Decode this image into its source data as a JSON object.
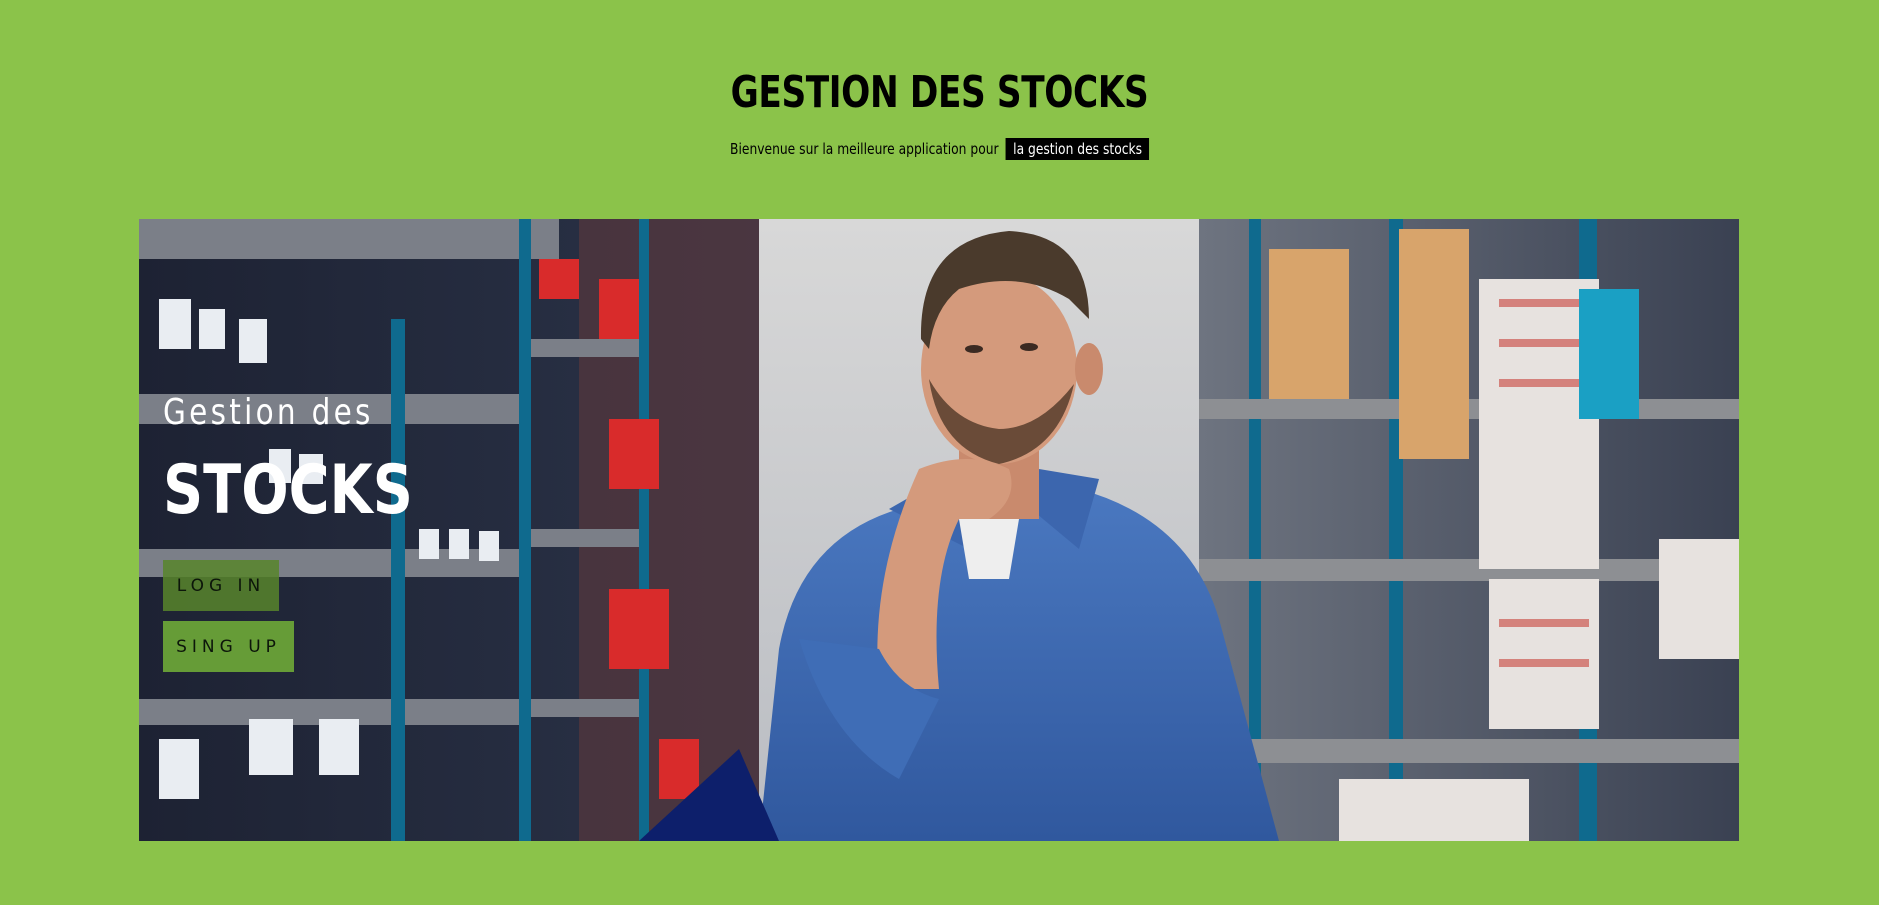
{
  "header": {
    "title": "GESTION DES STOCKS",
    "subtitle_prefix": "Bienvenue sur la meilleure application pour",
    "subtitle_highlight": "la gestion des stocks"
  },
  "hero": {
    "kicker": "Gestion des",
    "heading": "STOCKS",
    "login_label": "LOG IN",
    "signup_label": "SING UP"
  },
  "colors": {
    "page_background": "#8bc34a",
    "title_text": "#000000",
    "highlight_background": "#000000",
    "button_background": "#58852c"
  }
}
